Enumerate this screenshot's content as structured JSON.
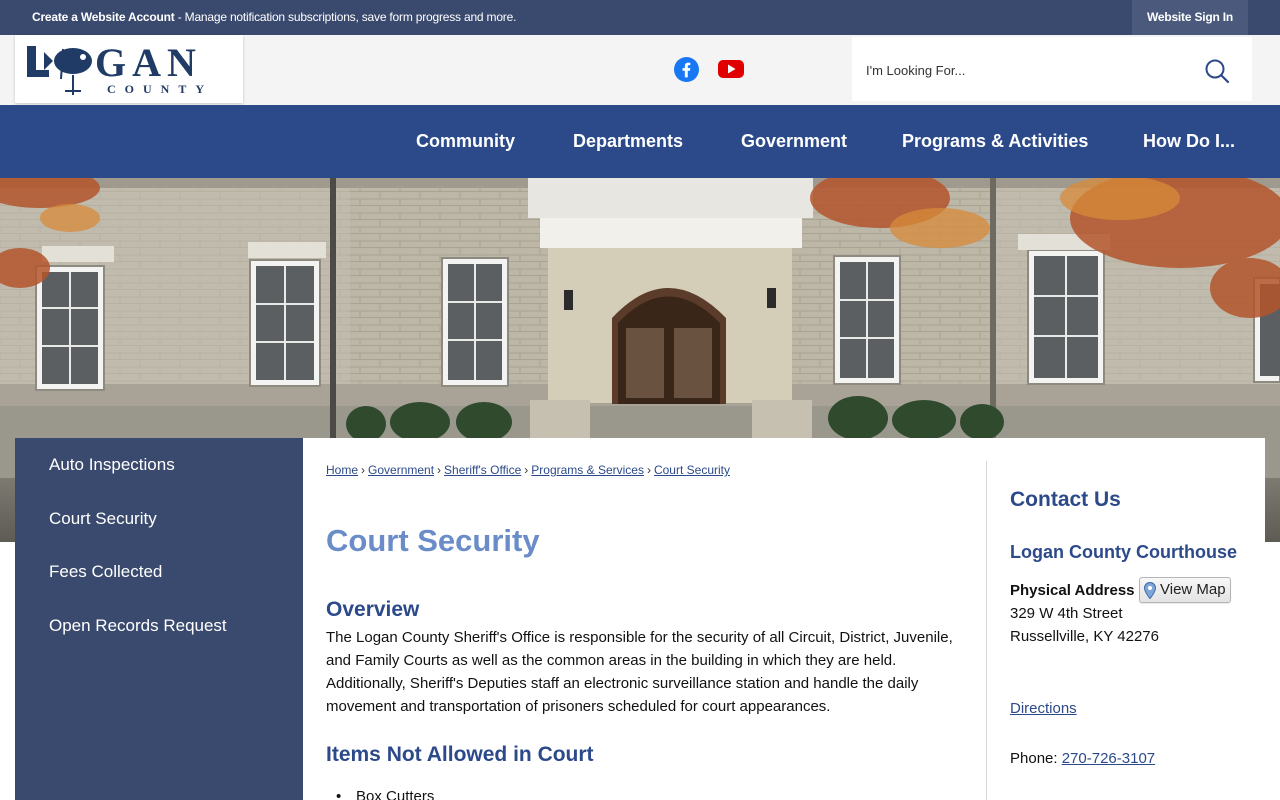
{
  "topbar": {
    "account_link": "Create a Website Account",
    "account_desc": " - Manage notification subscriptions, save form progress and more.",
    "sign_in": "Website Sign In"
  },
  "logo": {
    "line1": "LOGAN",
    "line2": "COUNTY"
  },
  "social": {
    "facebook_icon": "facebook-icon",
    "youtube_icon": "youtube-icon"
  },
  "search": {
    "placeholder": "I'm Looking For...",
    "icon": "search-icon"
  },
  "nav": {
    "items": [
      {
        "label": "Community"
      },
      {
        "label": "Departments"
      },
      {
        "label": "Government"
      },
      {
        "label": "Programs & Activities"
      },
      {
        "label": "How Do I..."
      }
    ]
  },
  "sidebar": {
    "items": [
      {
        "label": "Auto Inspections"
      },
      {
        "label": "Court Security"
      },
      {
        "label": "Fees Collected"
      },
      {
        "label": "Open Records Request"
      }
    ]
  },
  "breadcrumb": {
    "items": [
      {
        "label": "Home"
      },
      {
        "label": "Government"
      },
      {
        "label": "Sheriff's Office"
      },
      {
        "label": "Programs & Services"
      },
      {
        "label": "Court Security"
      }
    ],
    "separator": "›"
  },
  "main": {
    "title": "Court Security",
    "overview_heading": "Overview",
    "overview_text": "The Logan County Sheriff's Office is responsible for the security of all Circuit, District, Juvenile, and Family Courts as well as the common areas in the building in which they are held. Additionally, Sheriff's Deputies staff an electronic surveillance station and handle the daily movement and transportation of prisoners scheduled for court appearances.",
    "items_heading": "Items Not Allowed in Court",
    "items": [
      "Box Cutters"
    ]
  },
  "contact": {
    "title": "Contact Us",
    "location": "Logan County Courthouse",
    "address_label": "Physical Address",
    "view_map": "View Map",
    "street": "329 W 4th Street",
    "city": "Russellville, KY 42276",
    "directions": "Directions",
    "phone_label": "Phone: ",
    "phone": "270-726-3107"
  },
  "colors": {
    "topbar": "#3a4a6e",
    "nav": "#2c4a8a",
    "accent_title": "#6a8cc8",
    "sidebar": "#3a4a6e"
  }
}
